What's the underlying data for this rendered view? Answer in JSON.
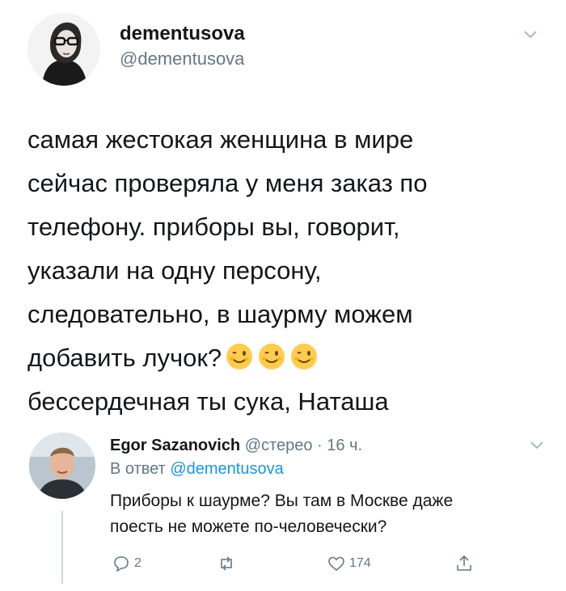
{
  "tweet": {
    "author_name": "dementusova",
    "author_handle": "@dementusova",
    "lines": [
      "самая жестокая женщина в мире",
      "сейчас проверяла у меня заказ по",
      "телефону. приборы вы, говорит,",
      "указали на одну персону,",
      "следовательно, в шаурму можем",
      "добавить лучок?",
      "бессердечная ты сука, Наташа"
    ],
    "emoji": "winking-face-emoji"
  },
  "reply": {
    "author_name": "Egor Sazanovich",
    "handle": "@стерео",
    "separator": "·",
    "time": "16 ч.",
    "in_reply_prefix": "В ответ",
    "in_reply_handle": "@dementusova",
    "text_lines": [
      "Приборы к шаурме? Вы там в Москве даже",
      "поесть не можете по-человечески?"
    ],
    "actions": {
      "reply_count": "2",
      "retweet_count": "",
      "like_count": "174"
    }
  },
  "colors": {
    "text": "#14171a",
    "secondary": "#657786",
    "link": "#1b95e0",
    "thread_line": "#ccd6dd"
  }
}
